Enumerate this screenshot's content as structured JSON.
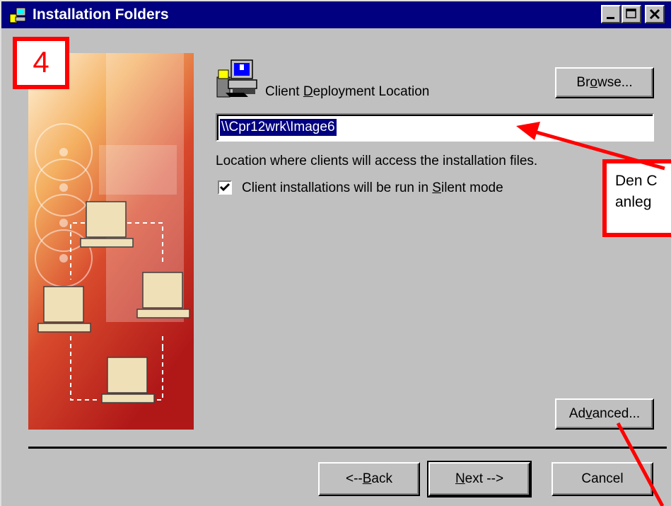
{
  "window": {
    "title": "Installation Folders",
    "controls": [
      "minimize-icon",
      "maximize-icon",
      "close-icon"
    ]
  },
  "annotation": {
    "step_number": "4",
    "callout_lines": [
      "Den C",
      "anleg"
    ]
  },
  "deployment": {
    "label_pre": "Client ",
    "label_mnemonic": "D",
    "label_post": "eployment Location",
    "path_value": "\\\\Cpr12wrk\\Image6",
    "description": "Location where clients will access the installation files.",
    "browse_pre": "Br",
    "browse_mnemonic": "o",
    "browse_post": "wse...",
    "icon": "client-computer-icon"
  },
  "silent_mode": {
    "checked": true,
    "label_pre": "Client installations will be run in ",
    "label_mnemonic": "S",
    "label_post": "ilent mode"
  },
  "buttons": {
    "advanced_pre": "Ad",
    "advanced_mnemonic": "v",
    "advanced_post": "anced...",
    "back_pre": "<--",
    "back_mnemonic": "B",
    "back_post": "ack",
    "next_mnemonic": "N",
    "next_post": "ext -->",
    "cancel": "Cancel"
  },
  "colors": {
    "titlebar": "#000080",
    "annotation": "#ff0000",
    "dialog": "#c0c0c0"
  }
}
